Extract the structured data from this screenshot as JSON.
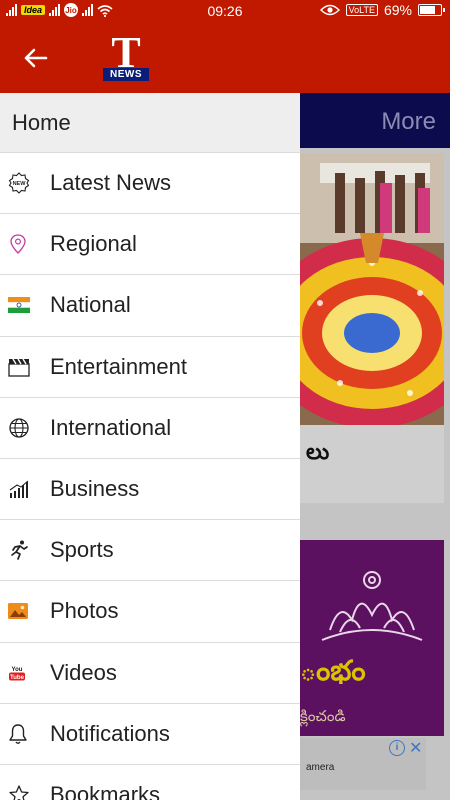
{
  "status_bar": {
    "carrier1": "Idea",
    "carrier2": "Jio",
    "time": "09:26",
    "volte": "VoLTE",
    "battery": "69%",
    "battery_level": 0.69
  },
  "app_bar": {
    "logo_letter": "T",
    "logo_word": "NEWS",
    "colors": {
      "bar": "#c01900",
      "logo_band": "#0b1d77"
    }
  },
  "drawer": {
    "home_label": "Home",
    "items": [
      {
        "label": "Latest News",
        "icon": "new-badge-icon"
      },
      {
        "label": "Regional",
        "icon": "location-pin-icon"
      },
      {
        "label": "National",
        "icon": "india-flag-icon"
      },
      {
        "label": "Entertainment",
        "icon": "clapperboard-icon"
      },
      {
        "label": "International",
        "icon": "globe-icon"
      },
      {
        "label": "Business",
        "icon": "bar-chart-icon"
      },
      {
        "label": "Sports",
        "icon": "runner-icon"
      },
      {
        "label": "Photos",
        "icon": "image-icon"
      },
      {
        "label": "Videos",
        "icon": "youtube-icon"
      },
      {
        "label": "Notifications",
        "icon": "bell-icon"
      },
      {
        "label": "Bookmarks",
        "icon": "star-icon"
      }
    ]
  },
  "background": {
    "tab_more": "More",
    "card_text": "లు",
    "ad_text1": "ంభం",
    "ad_text2": "క్లించండి",
    "banner_text": "amera"
  }
}
